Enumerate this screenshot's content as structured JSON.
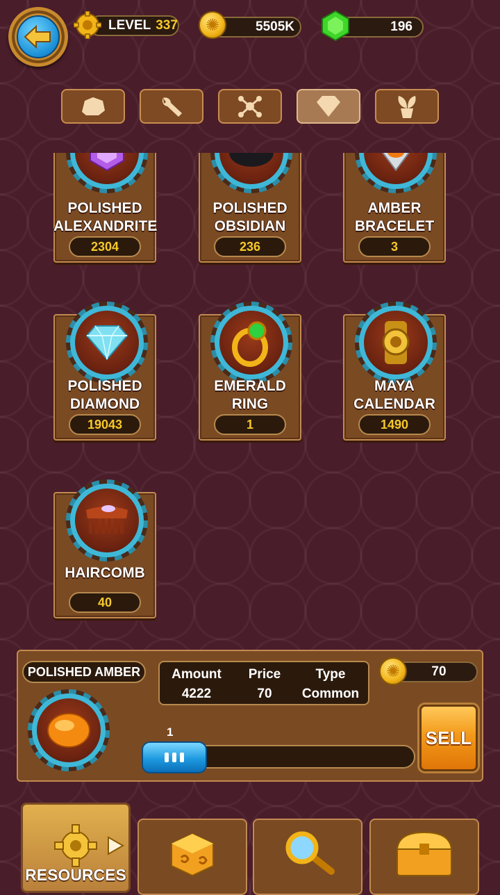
{
  "header": {
    "level_label": "LEVEL",
    "level_value": "337",
    "coins": "5505K",
    "gems": "196"
  },
  "category_tabs": [
    {
      "name": "ore",
      "icon": "rock-icon",
      "active": false
    },
    {
      "name": "tools",
      "icon": "wrench-icon",
      "active": false
    },
    {
      "name": "molecule",
      "icon": "molecule-icon",
      "active": false
    },
    {
      "name": "jewels",
      "icon": "diamond-icon",
      "active": true
    },
    {
      "name": "plants",
      "icon": "sprout-icon",
      "active": false
    }
  ],
  "items": [
    {
      "line1": "POLISHED",
      "line2": "ALEXANDRITE",
      "count": "2304",
      "icon": "alexandrite-icon"
    },
    {
      "line1": "POLISHED",
      "line2": "OBSIDIAN",
      "count": "236",
      "icon": "obsidian-icon"
    },
    {
      "line1": "AMBER",
      "line2": "BRACELET",
      "count": "3",
      "icon": "amber-bracelet-icon"
    },
    {
      "line1": "POLISHED",
      "line2": "DIAMOND",
      "count": "19043",
      "icon": "diamond-gem-icon"
    },
    {
      "line1": "EMERALD",
      "line2": "RING",
      "count": "1",
      "icon": "emerald-ring-icon"
    },
    {
      "line1": "MAYA",
      "line2": "CALENDAR",
      "count": "1490",
      "icon": "maya-calendar-icon"
    },
    {
      "line1": "HAIRCOMB",
      "line2": "",
      "count": "40",
      "icon": "haircomb-icon"
    }
  ],
  "selected": {
    "name": "POLISHED AMBER",
    "amount_label": "Amount",
    "amount_value": "4222",
    "price_label": "Price",
    "price_value": "70",
    "type_label": "Type",
    "type_value": "Common",
    "total_coins": "70",
    "quantity": "1",
    "sell_label": "SELL"
  },
  "bottom_nav": [
    {
      "label": "RESOURCES",
      "icon": "gear-icon",
      "active": true
    },
    {
      "label": "",
      "icon": "dice-icon",
      "active": false
    },
    {
      "label": "",
      "icon": "magnifier-icon",
      "active": false
    },
    {
      "label": "",
      "icon": "chest-icon",
      "active": false
    }
  ],
  "colors": {
    "background": "#4a1d2a",
    "card": "#7a4a23",
    "count_text": "#f7c92a",
    "sell_button": "#f39a1a",
    "slider": "#1e9ae0"
  }
}
